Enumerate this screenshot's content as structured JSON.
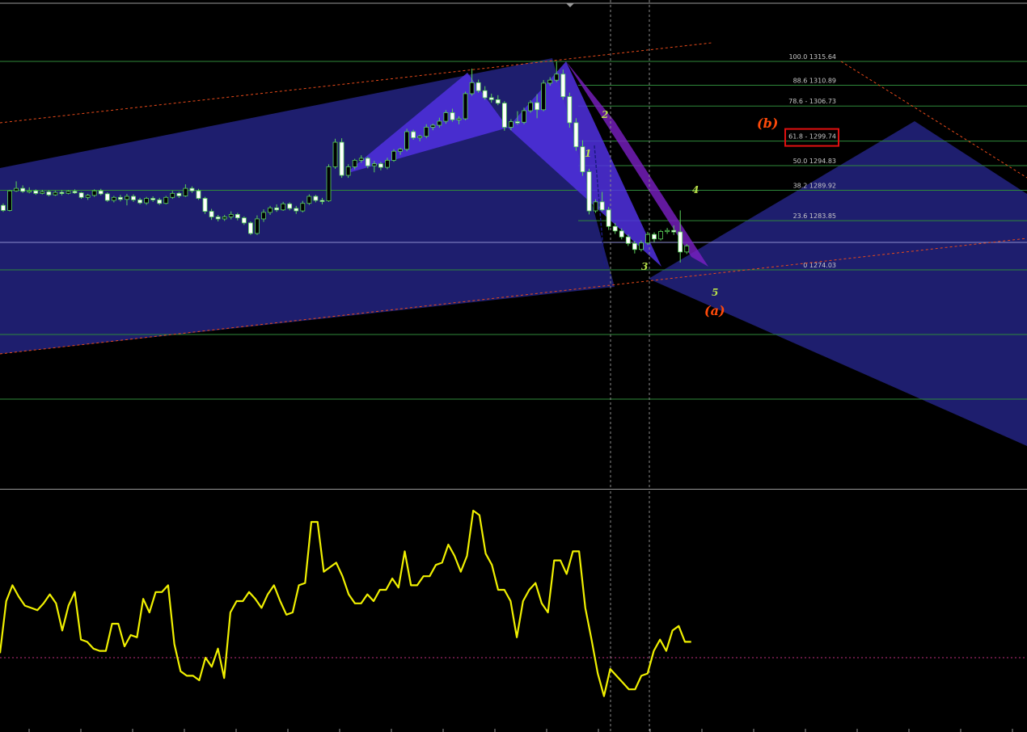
{
  "chart_data": [
    {
      "type": "candlestick",
      "title": "",
      "fib_levels": [
        {
          "label": "100.0 1315.64",
          "price": 1315.64
        },
        {
          "label": "88.6 1310.89",
          "price": 1310.89
        },
        {
          "label": "78.6 - 1306.73",
          "price": 1306.73
        },
        {
          "label": "61.8 - 1299.74",
          "price": 1299.74,
          "highlight": true
        },
        {
          "label": "50.0 1294.83",
          "price": 1294.83
        },
        {
          "label": "38.2 1289.92",
          "price": 1289.92
        },
        {
          "label": "23.6 1283.85",
          "price": 1283.85
        },
        {
          "label": "0 1274.03",
          "price": 1274.03
        }
      ],
      "wave_labels": [
        "1",
        "2",
        "3",
        "4",
        "5"
      ],
      "major_labels": [
        "(a)",
        "(b)"
      ],
      "ylim": [
        1255,
        1319
      ],
      "candles": [
        [
          1286.9,
          1287.3,
          1285.6,
          1285.9
        ],
        [
          1285.9,
          1290.0,
          1285.7,
          1289.8
        ],
        [
          1289.8,
          1291.7,
          1289.6,
          1290.3
        ],
        [
          1290.3,
          1290.9,
          1289.4,
          1289.7
        ],
        [
          1289.7,
          1290.5,
          1289.3,
          1289.8
        ],
        [
          1289.8,
          1290.1,
          1289.0,
          1289.3
        ],
        [
          1289.3,
          1290.0,
          1289.1,
          1289.6
        ],
        [
          1289.6,
          1289.9,
          1288.7,
          1289.0
        ],
        [
          1289.0,
          1289.8,
          1288.8,
          1289.5
        ],
        [
          1289.5,
          1289.9,
          1288.9,
          1289.3
        ],
        [
          1289.3,
          1289.9,
          1289.1,
          1289.7
        ],
        [
          1289.7,
          1290.1,
          1289.2,
          1289.4
        ],
        [
          1289.4,
          1289.6,
          1288.2,
          1288.5
        ],
        [
          1288.5,
          1289.2,
          1288.0,
          1288.9
        ],
        [
          1288.9,
          1290.1,
          1288.6,
          1289.8
        ],
        [
          1289.8,
          1290.2,
          1288.9,
          1289.2
        ],
        [
          1289.2,
          1289.5,
          1287.6,
          1287.9
        ],
        [
          1287.9,
          1288.8,
          1287.5,
          1288.5
        ],
        [
          1288.5,
          1289.0,
          1287.7,
          1288.1
        ],
        [
          1288.1,
          1289.2,
          1286.9,
          1288.7
        ],
        [
          1288.7,
          1289.1,
          1287.6,
          1288.0
        ],
        [
          1288.0,
          1288.4,
          1287.1,
          1287.4
        ],
        [
          1287.4,
          1288.6,
          1287.0,
          1288.3
        ],
        [
          1288.3,
          1288.7,
          1287.6,
          1288.0
        ],
        [
          1288.0,
          1288.4,
          1287.0,
          1287.3
        ],
        [
          1287.3,
          1288.8,
          1287.1,
          1288.5
        ],
        [
          1288.5,
          1289.8,
          1288.2,
          1289.3
        ],
        [
          1289.3,
          1289.6,
          1288.4,
          1288.8
        ],
        [
          1288.8,
          1291.1,
          1288.6,
          1290.3
        ],
        [
          1290.3,
          1290.7,
          1289.4,
          1289.8
        ],
        [
          1289.8,
          1290.2,
          1288.0,
          1288.3
        ],
        [
          1288.3,
          1288.6,
          1285.2,
          1285.7
        ],
        [
          1285.7,
          1286.2,
          1284.0,
          1284.6
        ],
        [
          1284.6,
          1285.0,
          1283.7,
          1284.2
        ],
        [
          1284.2,
          1285.0,
          1283.8,
          1284.6
        ],
        [
          1284.6,
          1285.7,
          1284.1,
          1285.1
        ],
        [
          1285.1,
          1285.4,
          1283.9,
          1284.4
        ],
        [
          1284.4,
          1284.7,
          1283.0,
          1283.4
        ],
        [
          1283.4,
          1283.7,
          1281.0,
          1281.3
        ],
        [
          1281.3,
          1284.9,
          1281.0,
          1284.2
        ],
        [
          1284.2,
          1286.1,
          1283.6,
          1285.5
        ],
        [
          1285.5,
          1286.8,
          1285.0,
          1286.4
        ],
        [
          1286.4,
          1287.1,
          1285.6,
          1286.0
        ],
        [
          1286.0,
          1287.6,
          1285.8,
          1287.2
        ],
        [
          1287.2,
          1287.5,
          1285.9,
          1286.3
        ],
        [
          1286.3,
          1286.8,
          1285.2,
          1285.8
        ],
        [
          1285.8,
          1287.8,
          1285.5,
          1287.3
        ],
        [
          1287.3,
          1289.1,
          1287.0,
          1288.7
        ],
        [
          1288.7,
          1289.0,
          1287.5,
          1287.9
        ],
        [
          1287.9,
          1288.4,
          1287.1,
          1287.8
        ],
        [
          1287.8,
          1295.1,
          1287.6,
          1294.6
        ],
        [
          1294.6,
          1300.2,
          1294.2,
          1299.5
        ],
        [
          1299.5,
          1300.3,
          1292.4,
          1292.9
        ],
        [
          1292.9,
          1295.1,
          1292.4,
          1294.6
        ],
        [
          1294.6,
          1296.2,
          1294.1,
          1295.9
        ],
        [
          1295.9,
          1296.9,
          1295.4,
          1296.3
        ],
        [
          1296.3,
          1296.6,
          1294.3,
          1294.8
        ],
        [
          1294.8,
          1295.8,
          1293.5,
          1295.2
        ],
        [
          1295.2,
          1295.6,
          1293.9,
          1294.5
        ],
        [
          1294.5,
          1296.4,
          1294.1,
          1295.9
        ],
        [
          1295.9,
          1298.1,
          1295.6,
          1297.7
        ],
        [
          1297.7,
          1298.4,
          1297.0,
          1298.1
        ],
        [
          1298.1,
          1302.2,
          1297.7,
          1301.6
        ],
        [
          1301.6,
          1302.0,
          1300.0,
          1300.4
        ],
        [
          1300.4,
          1301.0,
          1299.7,
          1300.7
        ],
        [
          1300.7,
          1303.1,
          1300.3,
          1302.5
        ],
        [
          1302.5,
          1303.2,
          1301.9,
          1302.9
        ],
        [
          1302.9,
          1304.4,
          1302.4,
          1303.7
        ],
        [
          1303.7,
          1305.9,
          1303.2,
          1305.4
        ],
        [
          1305.4,
          1306.2,
          1303.6,
          1304.0
        ],
        [
          1304.0,
          1304.7,
          1303.1,
          1304.2
        ],
        [
          1304.2,
          1309.6,
          1303.9,
          1309.2
        ],
        [
          1309.2,
          1314.2,
          1308.8,
          1311.4
        ],
        [
          1311.4,
          1312.0,
          1309.4,
          1309.8
        ],
        [
          1309.8,
          1310.7,
          1308.0,
          1308.4
        ],
        [
          1308.4,
          1309.2,
          1307.4,
          1308.0
        ],
        [
          1308.0,
          1308.9,
          1306.9,
          1307.3
        ],
        [
          1307.3,
          1307.7,
          1301.8,
          1302.5
        ],
        [
          1302.5,
          1304.1,
          1301.9,
          1303.6
        ],
        [
          1303.6,
          1305.7,
          1303.0,
          1303.5
        ],
        [
          1303.5,
          1306.4,
          1303.1,
          1305.8
        ],
        [
          1305.8,
          1307.9,
          1305.4,
          1307.4
        ],
        [
          1307.4,
          1309.1,
          1304.3,
          1306.0
        ],
        [
          1306.0,
          1311.9,
          1305.7,
          1311.3
        ],
        [
          1311.3,
          1312.5,
          1310.8,
          1311.9
        ],
        [
          1311.9,
          1315.6,
          1311.5,
          1313.1
        ],
        [
          1313.1,
          1314.0,
          1308.0,
          1308.6
        ],
        [
          1308.6,
          1309.4,
          1302.4,
          1303.4
        ],
        [
          1303.4,
          1304.3,
          1297.8,
          1298.6
        ],
        [
          1298.6,
          1299.9,
          1292.8,
          1293.6
        ],
        [
          1293.6,
          1294.2,
          1285.1,
          1285.8
        ],
        [
          1285.8,
          1288.1,
          1285.4,
          1287.6
        ],
        [
          1287.6,
          1289.6,
          1285.7,
          1286.0
        ],
        [
          1286.0,
          1286.6,
          1282.0,
          1282.7
        ],
        [
          1282.7,
          1283.4,
          1281.2,
          1281.8
        ],
        [
          1281.8,
          1282.3,
          1280.1,
          1280.6
        ],
        [
          1280.6,
          1281.1,
          1278.8,
          1279.3
        ],
        [
          1279.3,
          1279.8,
          1277.3,
          1278.1
        ],
        [
          1278.1,
          1279.9,
          1277.7,
          1279.4
        ],
        [
          1279.4,
          1281.6,
          1279.0,
          1281.1
        ],
        [
          1281.1,
          1281.5,
          1279.6,
          1280.2
        ],
        [
          1280.2,
          1282.0,
          1279.9,
          1281.7
        ],
        [
          1281.7,
          1282.4,
          1281.2,
          1281.9
        ],
        [
          1281.9,
          1282.9,
          1281.0,
          1281.6
        ],
        [
          1281.6,
          1285.9,
          1275.5,
          1277.6
        ],
        [
          1277.6,
          1279.2,
          1277.2,
          1278.8
        ]
      ]
    },
    {
      "type": "line",
      "title": "",
      "ylim": [
        0,
        100
      ],
      "baseline": 30,
      "series": [
        {
          "values": [
            32,
            55,
            62,
            57,
            53,
            52,
            51,
            54,
            58,
            54,
            42,
            53,
            59,
            38,
            37,
            34,
            33,
            33,
            45,
            45,
            35,
            40,
            39,
            56,
            50,
            59,
            59,
            62,
            36,
            24,
            22,
            22,
            20,
            30,
            26,
            34,
            21,
            50,
            55,
            55,
            59,
            56,
            52,
            58,
            62,
            55,
            49,
            50,
            62,
            63,
            90,
            90,
            68,
            70,
            72,
            66,
            58,
            54,
            54,
            58,
            55,
            60,
            60,
            65,
            61,
            77,
            62,
            62,
            66,
            66,
            71,
            72,
            80,
            75,
            68,
            75,
            95,
            93,
            76,
            71,
            60,
            60,
            55,
            39,
            55,
            60,
            63,
            54,
            50,
            73,
            73,
            67,
            77,
            77,
            52,
            38,
            23,
            13,
            25,
            22,
            19,
            16,
            16,
            22,
            23,
            33,
            38,
            33,
            42,
            44,
            37,
            37
          ]
        }
      ]
    }
  ]
}
